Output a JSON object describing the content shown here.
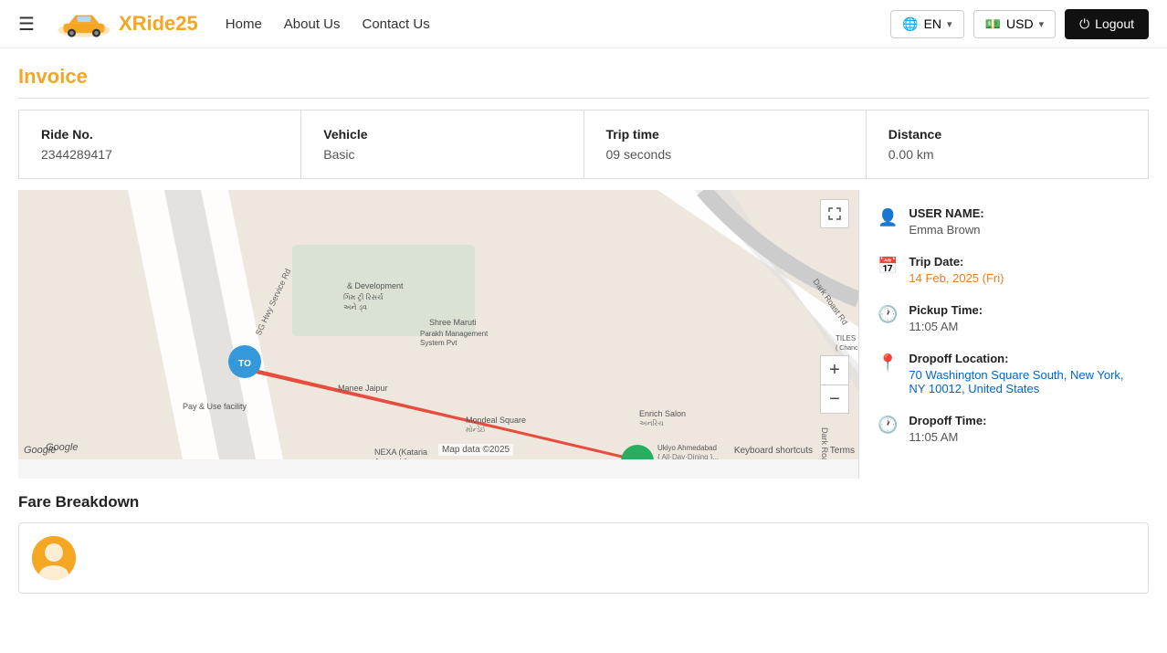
{
  "navbar": {
    "hamburger": "☰",
    "brand_name": "XRide",
    "brand_number": "25",
    "links": [
      {
        "label": "Home",
        "href": "#"
      },
      {
        "label": "About Us",
        "href": "#"
      },
      {
        "label": "Contact Us",
        "href": "#"
      }
    ],
    "language": {
      "value": "EN",
      "icon": "🌐"
    },
    "currency": {
      "value": "USD",
      "icon": "💵"
    },
    "logout_label": "Logout"
  },
  "page": {
    "title": "Invoice"
  },
  "stats": [
    {
      "label": "Ride No.",
      "value": "2344289417"
    },
    {
      "label": "Vehicle",
      "value": "Basic"
    },
    {
      "label": "Trip time",
      "value": "09 seconds"
    },
    {
      "label": "Distance",
      "value": "0.00 km"
    }
  ],
  "map": {
    "attribution": "Map data ©2025",
    "terms": "Terms",
    "keyboard": "Keyboard shortcuts",
    "zoom_in": "+",
    "zoom_out": "−",
    "fullscreen_icon": "⛶"
  },
  "sidebar": {
    "username_label": "USER NAME:",
    "username_value": "Emma Brown",
    "trip_date_label": "Trip Date:",
    "trip_date_value": "14 Feb, 2025 (Fri)",
    "pickup_time_label": "Pickup Time:",
    "pickup_time_value": "11:05 AM",
    "dropoff_location_label": "Dropoff Location:",
    "dropoff_location_value": "70 Washington Square South, New York, NY 10012, United States",
    "dropoff_time_label": "Dropoff Time:",
    "dropoff_time_value": "11:05 AM"
  },
  "fare": {
    "title": "Fare Breakdown"
  },
  "icons": {
    "person": "👤",
    "calendar": "📅",
    "clock": "🕐",
    "location": "📍",
    "clock2": "🕐",
    "power": "⏻"
  },
  "colors": {
    "brand_orange": "#f5a623",
    "brand_dark": "#111111",
    "highlight_blue": "#0066cc",
    "highlight_orange": "#e67e22"
  }
}
